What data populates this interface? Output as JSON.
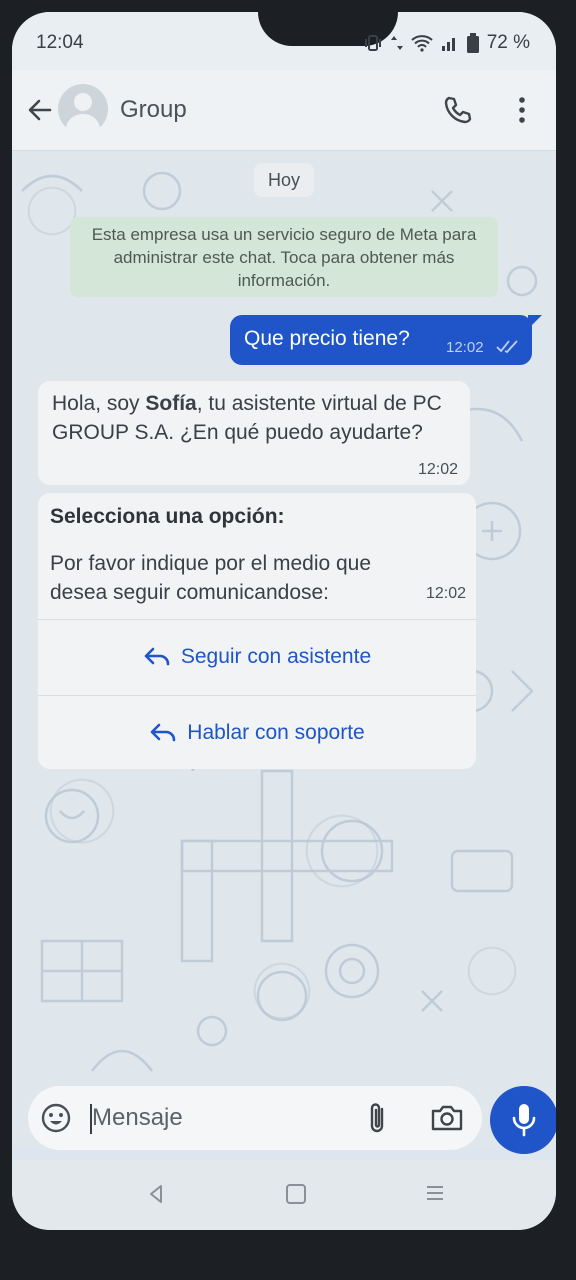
{
  "status_bar": {
    "time": "12:04",
    "battery": "72 %"
  },
  "header": {
    "contact_name": "Group"
  },
  "chat": {
    "date_chip": "Hoy",
    "system_note": "Esta empresa usa un servicio seguro de Meta para administrar este chat. Toca para obtener más información.",
    "outgoing": {
      "text": "Que precio tiene?",
      "time": "12:02"
    },
    "incoming": {
      "text_prefix": "Hola, soy ",
      "text_bold": "Sofía",
      "text_suffix": ", tu asistente virtual de PC GROUP S.A. ¿En qué puedo ayudarte?",
      "time": "12:02"
    },
    "options_message": {
      "title": "Selecciona una opción:",
      "body": "Por favor indique por el medio que desea seguir comunicandose:",
      "time": "12:02",
      "buttons": [
        {
          "label": "Seguir con asistente"
        },
        {
          "label": "Hablar con soporte"
        }
      ]
    }
  },
  "composer": {
    "placeholder": "Mensaje"
  },
  "colors": {
    "accent": "#1f55c9",
    "system_note_bg": "#d4e6d7"
  },
  "icons": [
    "back-arrow-icon",
    "avatar",
    "phone-icon",
    "more-vert-icon",
    "double-check-icon",
    "reply-icon",
    "emoji-icon",
    "attach-icon",
    "camera-icon",
    "mic-icon"
  ]
}
